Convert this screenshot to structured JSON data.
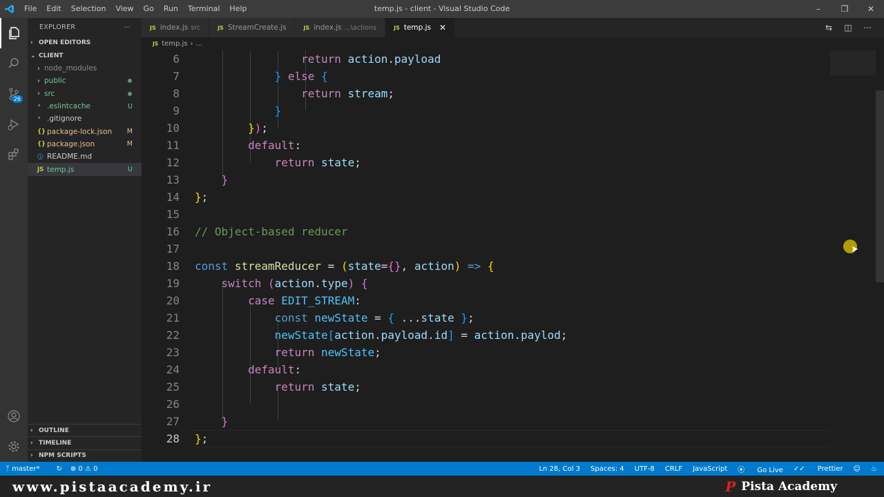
{
  "titlebar": {
    "menu": [
      "File",
      "Edit",
      "Selection",
      "View",
      "Go",
      "Run",
      "Terminal",
      "Help"
    ],
    "window_title": "temp.js - client - Visual Studio Code"
  },
  "activity": {
    "scm_badge": "26"
  },
  "sidebar": {
    "title": "EXPLORER",
    "open_editors": "OPEN EDITORS",
    "root": "CLIENT",
    "items": [
      {
        "label": "node_modules",
        "kind": "folder",
        "color": "#8c8c8c",
        "status": ""
      },
      {
        "label": "public",
        "kind": "folder",
        "color": "#73c991",
        "status": "dot"
      },
      {
        "label": "src",
        "kind": "folder",
        "color": "#73c991",
        "status": "dot"
      },
      {
        "label": ".eslintcache",
        "kind": "file",
        "color": "#73c991",
        "status": "U"
      },
      {
        "label": ".gitignore",
        "kind": "file",
        "color": "#cccccc",
        "status": ""
      },
      {
        "label": "package-lock.json",
        "kind": "json",
        "color": "#e2c08d",
        "status": "M"
      },
      {
        "label": "package.json",
        "kind": "json",
        "color": "#e2c08d",
        "status": "M"
      },
      {
        "label": "README.md",
        "kind": "md",
        "color": "#cccccc",
        "status": ""
      },
      {
        "label": "temp.js",
        "kind": "js",
        "color": "#73c991",
        "status": "U"
      }
    ],
    "outline": "OUTLINE",
    "timeline": "TIMELINE",
    "npm": "NPM SCRIPTS"
  },
  "tabs": [
    {
      "label": "index.js",
      "desc": "src"
    },
    {
      "label": "StreamCreate.js",
      "desc": ""
    },
    {
      "label": "index.js",
      "desc": "...\\actions"
    },
    {
      "label": "temp.js",
      "desc": ""
    }
  ],
  "breadcrumb": {
    "file": "temp.js",
    "rest": "..."
  },
  "editor": {
    "line_numbers": [
      "6",
      "7",
      "8",
      "9",
      "10",
      "11",
      "12",
      "13",
      "14",
      "15",
      "16",
      "17",
      "18",
      "19",
      "20",
      "21",
      "22",
      "23",
      "24",
      "25",
      "26",
      "27",
      "28"
    ]
  },
  "status": {
    "branch": "master*",
    "problems": "⊗ 0 ⚠ 0",
    "position": "Ln 28, Col 3",
    "spaces": "Spaces: 4",
    "encoding": "UTF-8",
    "eol": "CRLF",
    "language": "JavaScript",
    "golive": "Go Live",
    "prettier": "Prettier"
  },
  "banner": {
    "url": "www.pistaacademy.ir",
    "brand": "Pista Academy"
  }
}
